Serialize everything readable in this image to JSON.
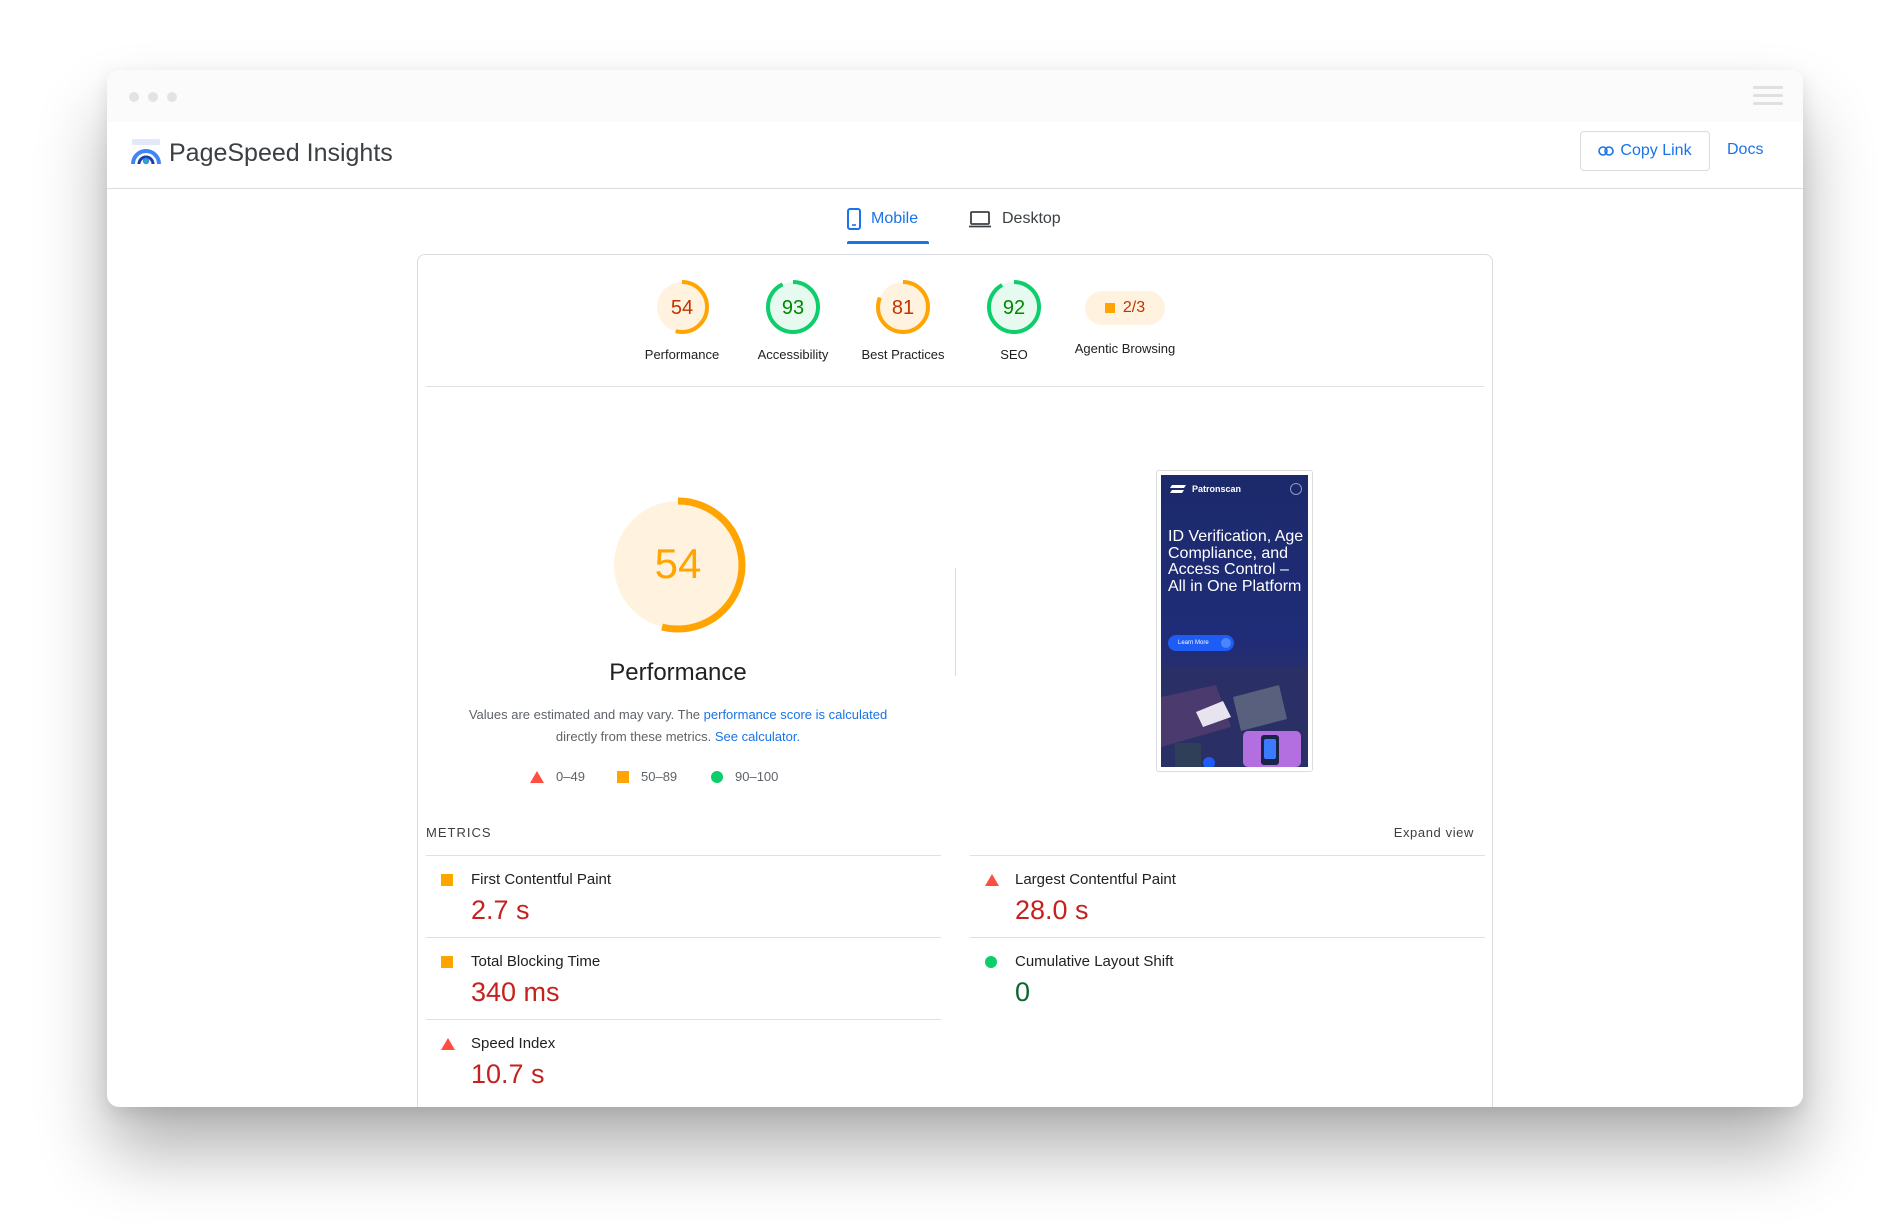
{
  "app": {
    "title": "PageSpeed Insights"
  },
  "header": {
    "copy_link_label": "Copy Link",
    "docs_label": "Docs"
  },
  "tabs": [
    {
      "label": "Mobile",
      "active": true
    },
    {
      "label": "Desktop",
      "active": false
    }
  ],
  "categories": [
    {
      "label": "Performance",
      "score": 54,
      "rating": "average",
      "color": "#ffa400",
      "text_color": "#c33300"
    },
    {
      "label": "Accessibility",
      "score": 93,
      "rating": "pass",
      "color": "#0cce6b",
      "text_color": "#008800"
    },
    {
      "label": "Best Practices",
      "score": 81,
      "rating": "average",
      "color": "#ffa400",
      "text_color": "#c33300"
    },
    {
      "label": "SEO",
      "score": 92,
      "rating": "pass",
      "color": "#0cce6b",
      "text_color": "#008800"
    },
    {
      "label": "Agentic Browsing",
      "value": "2/3",
      "rating": "average",
      "color": "#ffa400"
    }
  ],
  "performance": {
    "score": 54,
    "title": "Performance",
    "note_prefix": "Values are estimated and may vary. The ",
    "note_link1": "performance score is calculated",
    "note_middle": " directly from these metrics. ",
    "note_link2": "See calculator."
  },
  "legend": [
    {
      "label": "0–49",
      "shape": "triangle",
      "color": "#ff4e42"
    },
    {
      "label": "50–89",
      "shape": "square",
      "color": "#ffa400"
    },
    {
      "label": "90–100",
      "shape": "circle",
      "color": "#0cce6b"
    }
  ],
  "screenshot": {
    "brand": "Patronscan",
    "headline": "ID Verification, Age Compliance, and Access Control – All in One Platform",
    "cta": "Learn More"
  },
  "metrics": {
    "heading": "METRICS",
    "expand_label": "Expand view",
    "items": [
      {
        "label": "First Contentful Paint",
        "value": "2.7 s",
        "rating": "average"
      },
      {
        "label": "Largest Contentful Paint",
        "value": "28.0 s",
        "rating": "fail"
      },
      {
        "label": "Total Blocking Time",
        "value": "340 ms",
        "rating": "average"
      },
      {
        "label": "Cumulative Layout Shift",
        "value": "0",
        "rating": "pass"
      },
      {
        "label": "Speed Index",
        "value": "10.7 s",
        "rating": "fail"
      }
    ]
  },
  "colors": {
    "accent": "#1a73e8",
    "fail": "#ff4e42",
    "average": "#ffa400",
    "pass": "#0cce6b"
  }
}
